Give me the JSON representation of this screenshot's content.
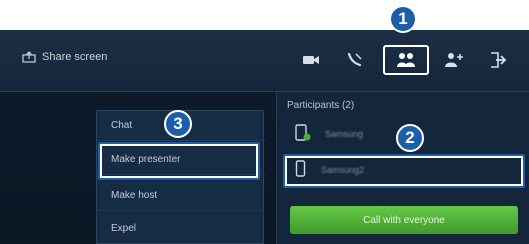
{
  "toolbar": {
    "share_label": "Share screen",
    "icons": [
      "video-icon",
      "mute-call-icon",
      "participants-icon",
      "add-participant-icon",
      "leave-icon"
    ]
  },
  "participants": {
    "title": "Participants (2)",
    "rows": [
      {
        "name": "Samsung"
      },
      {
        "name": "Samsung2"
      }
    ],
    "call_label": "Call with everyone"
  },
  "menu": {
    "items": [
      {
        "label": "Chat"
      },
      {
        "label": "Make presenter"
      },
      {
        "label": "Make host"
      },
      {
        "label": "Expel"
      }
    ]
  },
  "callouts": {
    "one": "1",
    "two": "2",
    "three": "3"
  },
  "colors": {
    "accent_blue": "#1b5fa8",
    "call_green": "#4faf36",
    "panel_bg": "#13263b"
  }
}
